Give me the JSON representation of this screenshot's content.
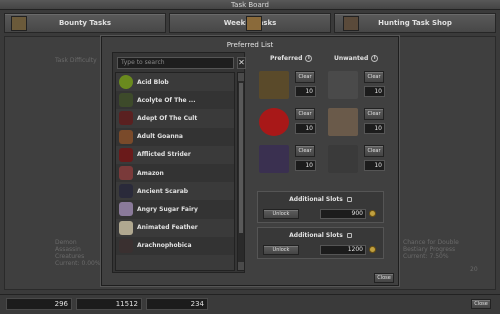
{
  "window": {
    "title": "Task Board"
  },
  "tabs": [
    {
      "label": "Bounty Tasks"
    },
    {
      "label": "Weekly Tasks"
    },
    {
      "label": "Hunting Task Shop"
    }
  ],
  "background": {
    "task_difficulty": "Task Difficulty",
    "left_card": "Demon Assassin Creatures Current: 0.00%",
    "right_card": "Chance for Double Bestiary Progress Current: 7.50%",
    "right_value": "20"
  },
  "modal": {
    "title": "Preferred List",
    "search_placeholder": "Type to search",
    "clear_search": "✕",
    "creatures": [
      {
        "name": "Acid Blob",
        "color": "#6a8a1e"
      },
      {
        "name": "Acolyte Of The ...",
        "color": "#3d4a2a"
      },
      {
        "name": "Adept Of The Cult",
        "color": "#5a2020"
      },
      {
        "name": "Adult Goanna",
        "color": "#7a4a2a"
      },
      {
        "name": "Afflicted Strider",
        "color": "#6a1a1a"
      },
      {
        "name": "Amazon",
        "color": "#7a3a3a"
      },
      {
        "name": "Ancient Scarab",
        "color": "#2a2a3a"
      },
      {
        "name": "Angry Sugar Fairy",
        "color": "#8a7a9a"
      },
      {
        "name": "Animated Feather",
        "color": "#b0a890"
      },
      {
        "name": "Arachnophobica",
        "color": "#3a3030"
      }
    ],
    "preferred_header": "Preferred",
    "unwanted_header": "Unwanted",
    "info_icon": "i",
    "preferred_slots": [
      {
        "clear_label": "Clear",
        "count": "10",
        "color": "#5a4a2a"
      },
      {
        "clear_label": "Clear",
        "count": "10",
        "color": "#a81818"
      },
      {
        "clear_label": "Clear",
        "count": "10",
        "color": "#3a3050"
      }
    ],
    "unwanted_slots": [
      {
        "clear_label": "Clear",
        "count": "10",
        "color": "#4a4a4a"
      },
      {
        "clear_label": "Clear",
        "count": "10",
        "color": "#6a5a4a"
      },
      {
        "clear_label": "Clear",
        "count": "10",
        "color": "#3a3a3a"
      }
    ],
    "additional_slots": [
      {
        "label": "Additional Slots",
        "unlock_label": "Unlock",
        "price": "900"
      },
      {
        "label": "Additional Slots",
        "unlock_label": "Unlock",
        "price": "1200"
      }
    ],
    "close_label": "Close"
  },
  "statusbar": {
    "counters": [
      "296",
      "11512",
      "234"
    ],
    "close_label": "Close"
  }
}
